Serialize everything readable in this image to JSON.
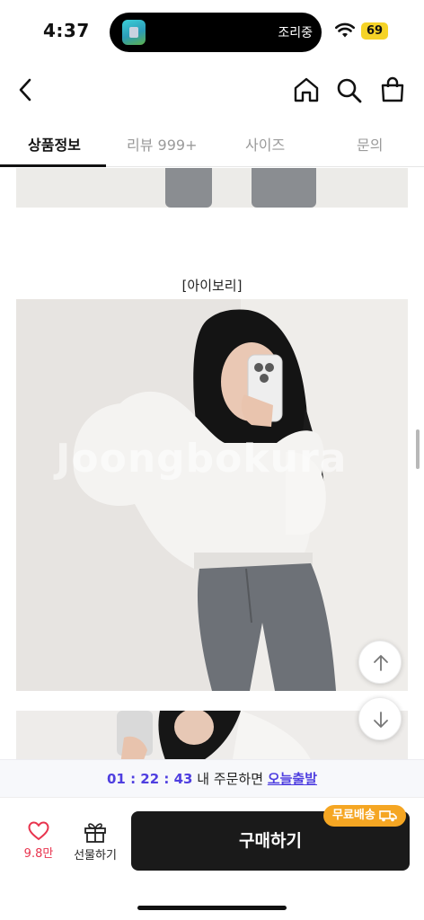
{
  "status_bar": {
    "time": "4:37",
    "live_activity_label": "조리중",
    "battery": "69",
    "icons": [
      "app-icon",
      "wifi-icon"
    ]
  },
  "nav": {
    "icons": [
      "back-icon",
      "home-icon",
      "search-icon",
      "shopping-bag-icon"
    ]
  },
  "tabs": [
    {
      "label": "상품정보",
      "active": true
    },
    {
      "label": "리뷰 999+",
      "active": false
    },
    {
      "label": "사이즈",
      "active": false
    },
    {
      "label": "문의",
      "active": false
    }
  ],
  "content": {
    "color_caption": "[아이보리]",
    "watermark": "Joongbokura"
  },
  "fab": {
    "icons": [
      "arrow-up-icon",
      "arrow-down-icon"
    ]
  },
  "delivery_banner": {
    "countdown": "01 : 22 : 43",
    "middle_text": " 내 주문하면 ",
    "highlight": "오늘출발"
  },
  "bottom_bar": {
    "like_count": "9.8만",
    "gift_label": "선물하기",
    "buy_label": "구매하기",
    "free_shipping_badge": "무료배송"
  },
  "colors": {
    "accent_purple": "#4f3fe0",
    "like_red": "#e8344e",
    "badge_orange": "#f5a623",
    "buy_button": "#1a1a1a"
  }
}
